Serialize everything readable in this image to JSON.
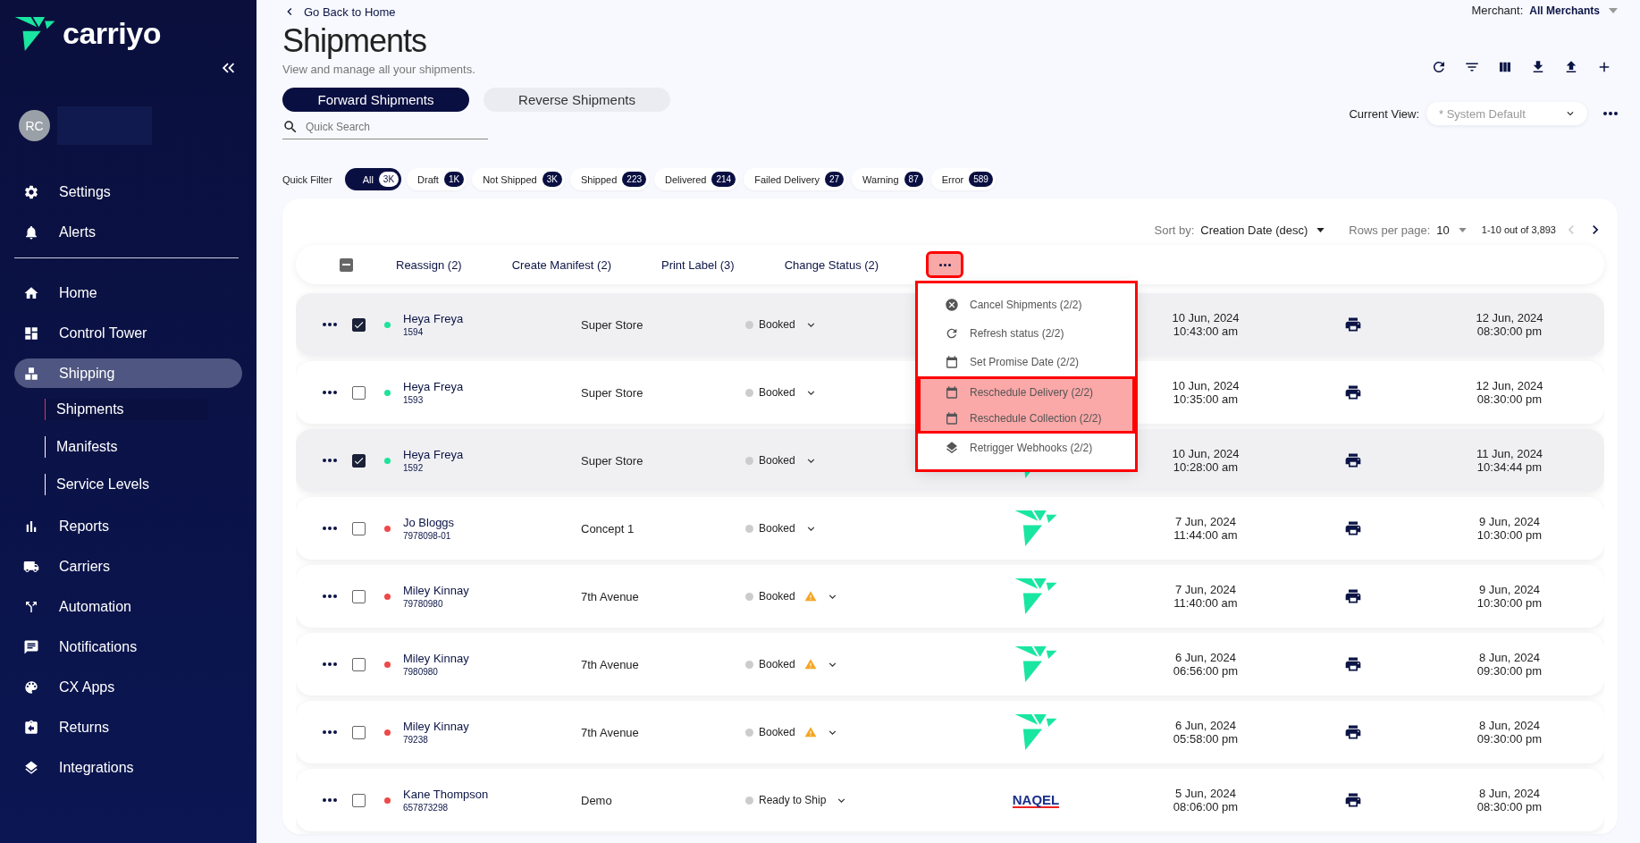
{
  "sidebar": {
    "logo_text": "carriyo",
    "avatar": "RC",
    "top_items": [
      {
        "label": "Settings"
      },
      {
        "label": "Alerts"
      }
    ],
    "items": [
      {
        "label": "Home",
        "selected": false
      },
      {
        "label": "Control Tower",
        "selected": false
      },
      {
        "label": "Shipping",
        "selected": true,
        "children": [
          {
            "label": "Shipments",
            "selected": true
          },
          {
            "label": "Manifests",
            "selected": false
          },
          {
            "label": "Service Levels",
            "selected": false
          }
        ]
      },
      {
        "label": "Reports",
        "selected": false
      },
      {
        "label": "Carriers",
        "selected": false
      },
      {
        "label": "Automation",
        "selected": false
      },
      {
        "label": "Notifications",
        "selected": false
      },
      {
        "label": "CX Apps",
        "selected": false
      },
      {
        "label": "Returns",
        "selected": false
      },
      {
        "label": "Integrations",
        "selected": false
      }
    ]
  },
  "header": {
    "back_link": "Go Back to Home",
    "title": "Shipments",
    "subtitle": "View and manage all your shipments.",
    "merchant_label": "Merchant:",
    "merchant_value": "All Merchants"
  },
  "tabs": [
    {
      "label": "Forward Shipments",
      "selected": true
    },
    {
      "label": "Reverse Shipments",
      "selected": false
    }
  ],
  "search": {
    "placeholder": "Quick Search"
  },
  "current_view": {
    "label": "Current View:",
    "placeholder": "* System Default"
  },
  "quick_filter": {
    "label": "Quick Filter",
    "chips": [
      {
        "label": "All",
        "count": "3K",
        "selected": true
      },
      {
        "label": "Draft",
        "count": "1K",
        "selected": false
      },
      {
        "label": "Not Shipped",
        "count": "3K",
        "selected": false
      },
      {
        "label": "Shipped",
        "count": "223",
        "selected": false
      },
      {
        "label": "Delivered",
        "count": "214",
        "selected": false
      },
      {
        "label": "Failed Delivery",
        "count": "27",
        "selected": false
      },
      {
        "label": "Warning",
        "count": "87",
        "selected": false
      },
      {
        "label": "Error",
        "count": "589",
        "selected": false
      }
    ]
  },
  "pagination": {
    "sort_label": "Sort by:",
    "sort_value": "Creation Date (desc)",
    "rows_label": "Rows per page:",
    "rows_value": "10",
    "range": "1-10 out of 3,893"
  },
  "bulk_actions": {
    "select_all_indeterminate": true,
    "actions": [
      "Reassign (2)",
      "Create Manifest (2)",
      "Print Label (3)",
      "Change Status (2)"
    ],
    "more_highlighted": true,
    "menu": {
      "outlined": true,
      "items": [
        {
          "label": "Cancel Shipments (2/2)",
          "highlighted": false
        },
        {
          "label": "Refresh status (2/2)",
          "highlighted": false
        },
        {
          "label": "Set Promise Date (2/2)",
          "highlighted": false
        },
        {
          "label": "Reschedule Delivery (2/2)",
          "highlighted": true
        },
        {
          "label": "Reschedule Collection (2/2)",
          "highlighted": true
        },
        {
          "label": "Retrigger Webhooks (2/2)",
          "highlighted": false
        }
      ]
    }
  },
  "rows": [
    {
      "checked": true,
      "color": "#1ee39a",
      "name": "Heya Freya",
      "id": "1594",
      "store": "Super Store",
      "status": "Booked",
      "warning": false,
      "created_date": "10 Jun, 2024",
      "created_time": "10:43:00 am",
      "promise_date": "12 Jun, 2024",
      "promise_time": "08:30:00 pm"
    },
    {
      "checked": false,
      "color": "#1ee39a",
      "name": "Heya Freya",
      "id": "1593",
      "store": "Super Store",
      "status": "Booked",
      "warning": false,
      "created_date": "10 Jun, 2024",
      "created_time": "10:35:00 am",
      "promise_date": "12 Jun, 2024",
      "promise_time": "08:30:00 pm"
    },
    {
      "checked": true,
      "color": "#1ee39a",
      "name": "Heya Freya",
      "id": "1592",
      "store": "Super Store",
      "status": "Booked",
      "warning": false,
      "carrier": {
        "kind": "bird"
      },
      "created_date": "10 Jun, 2024",
      "created_time": "10:28:00 am",
      "promise_date": "11 Jun, 2024",
      "promise_time": "10:34:44 pm"
    },
    {
      "checked": false,
      "color": "#f04848",
      "name": "Jo Bloggs",
      "id": "7978098-01",
      "store": "Concept 1",
      "status": "Booked",
      "warning": false,
      "carrier": {
        "kind": "bird"
      },
      "created_date": "7 Jun, 2024",
      "created_time": "11:44:00 am",
      "promise_date": "9 Jun, 2024",
      "promise_time": "10:30:00 pm"
    },
    {
      "checked": false,
      "color": "#f04848",
      "name": "Miley Kinnay",
      "id": "79780980",
      "store": "7th Avenue",
      "status": "Booked",
      "warning": true,
      "carrier": {
        "kind": "bird"
      },
      "created_date": "7 Jun, 2024",
      "created_time": "11:40:00 am",
      "promise_date": "9 Jun, 2024",
      "promise_time": "10:30:00 pm"
    },
    {
      "checked": false,
      "color": "#f04848",
      "name": "Miley Kinnay",
      "id": "7980980",
      "store": "7th Avenue",
      "status": "Booked",
      "warning": true,
      "carrier": {
        "kind": "bird"
      },
      "created_date": "6 Jun, 2024",
      "created_time": "06:56:00 pm",
      "promise_date": "8 Jun, 2024",
      "promise_time": "09:30:00 pm"
    },
    {
      "checked": false,
      "color": "#f04848",
      "name": "Miley Kinnay",
      "id": "79238",
      "store": "7th Avenue",
      "status": "Booked",
      "warning": true,
      "carrier": {
        "kind": "bird"
      },
      "created_date": "6 Jun, 2024",
      "created_time": "05:58:00 pm",
      "promise_date": "8 Jun, 2024",
      "promise_time": "09:30:00 pm"
    },
    {
      "checked": false,
      "color": "#f04848",
      "name": "Kane Thompson",
      "id": "657873298",
      "store": "Demo",
      "status": "Ready to Ship",
      "warning": false,
      "carrier": {
        "kind": "wordmark",
        "label": "NAQEL"
      },
      "created_date": "5 Jun, 2024",
      "created_time": "08:06:00 pm",
      "promise_date": "8 Jun, 2024",
      "promise_time": "08:30:00 pm"
    }
  ]
}
